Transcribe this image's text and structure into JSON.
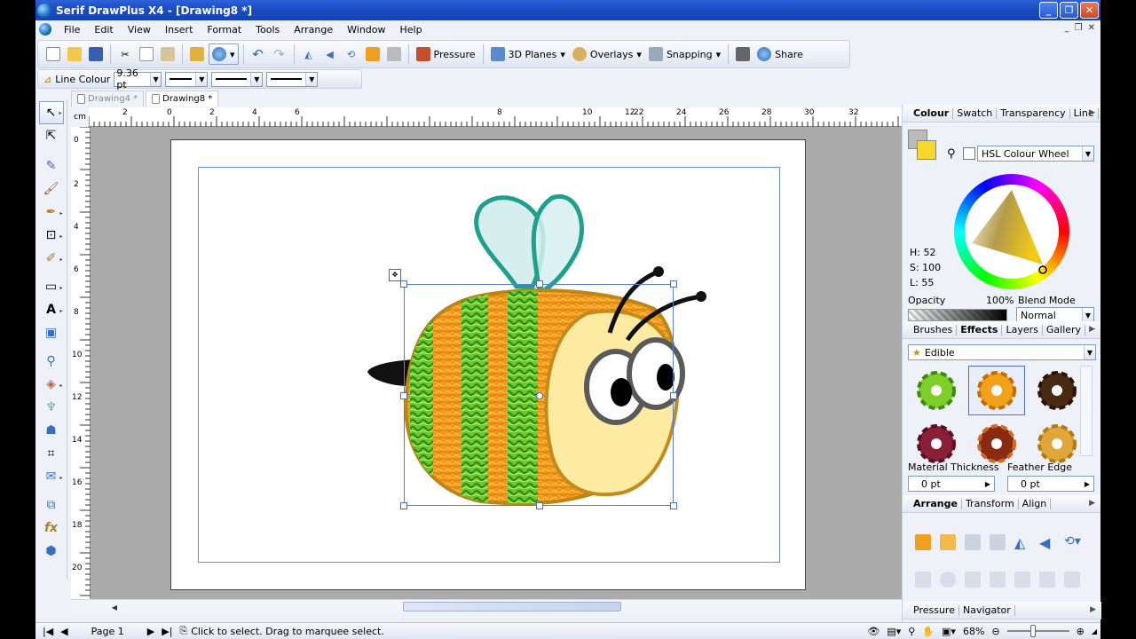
{
  "window": {
    "title": "Serif DrawPlus X4 - [Drawing8 *]"
  },
  "menu": [
    "File",
    "Edit",
    "View",
    "Insert",
    "Format",
    "Tools",
    "Arrange",
    "Window",
    "Help"
  ],
  "toolbar": {
    "pressure_label": "Pressure",
    "planes_label": "3D Planes",
    "overlays_label": "Overlays",
    "snapping_label": "Snapping",
    "share_label": "Share"
  },
  "context_bar": {
    "line_colour_label": "Line Colour",
    "line_width": "9.36 pt"
  },
  "doc_tabs": [
    "Drawing4 *",
    "Drawing8 *"
  ],
  "ruler": {
    "unit": "cm",
    "h_ticks": [
      "2",
      "0",
      "2",
      "4",
      "6",
      "8",
      "10",
      "12",
      "22",
      "24",
      "26",
      "28",
      "30",
      "32"
    ],
    "v_ticks": [
      "0",
      "2",
      "4",
      "6",
      "8",
      "10",
      "12",
      "14",
      "16",
      "18",
      "20"
    ]
  },
  "colour_panel": {
    "tabs": [
      "Colour",
      "Swatch",
      "Transparency",
      "Line"
    ],
    "mode": "HSL Colour Wheel",
    "h": "H: 52",
    "s": "S: 100",
    "l": "L: 55",
    "opacity_label": "Opacity",
    "opacity_value": "100%",
    "blend_label": "Blend Mode",
    "blend_value": "Normal",
    "fill_colour": "#f6d92a"
  },
  "effects_panel": {
    "tabs": [
      "Brushes",
      "Effects",
      "Layers",
      "Gallery"
    ],
    "category": "Edible",
    "material_label": "Material Thickness",
    "material_value": "0 pt",
    "feather_label": "Feather Edge",
    "feather_value": "0 pt",
    "swatches": [
      "#7fcf2a",
      "#f2a21a",
      "#4a2a12",
      "#8a1f3a",
      "#8a2a10",
      "#e0a63a"
    ]
  },
  "arrange_panel": {
    "tabs": [
      "Arrange",
      "Transform",
      "Align"
    ]
  },
  "pressure_panel": {
    "tabs": [
      "Pressure",
      "Navigator"
    ]
  },
  "status": {
    "page": "Page 1",
    "hint": "Click to select. Drag to marquee select.",
    "zoom": "68%"
  }
}
